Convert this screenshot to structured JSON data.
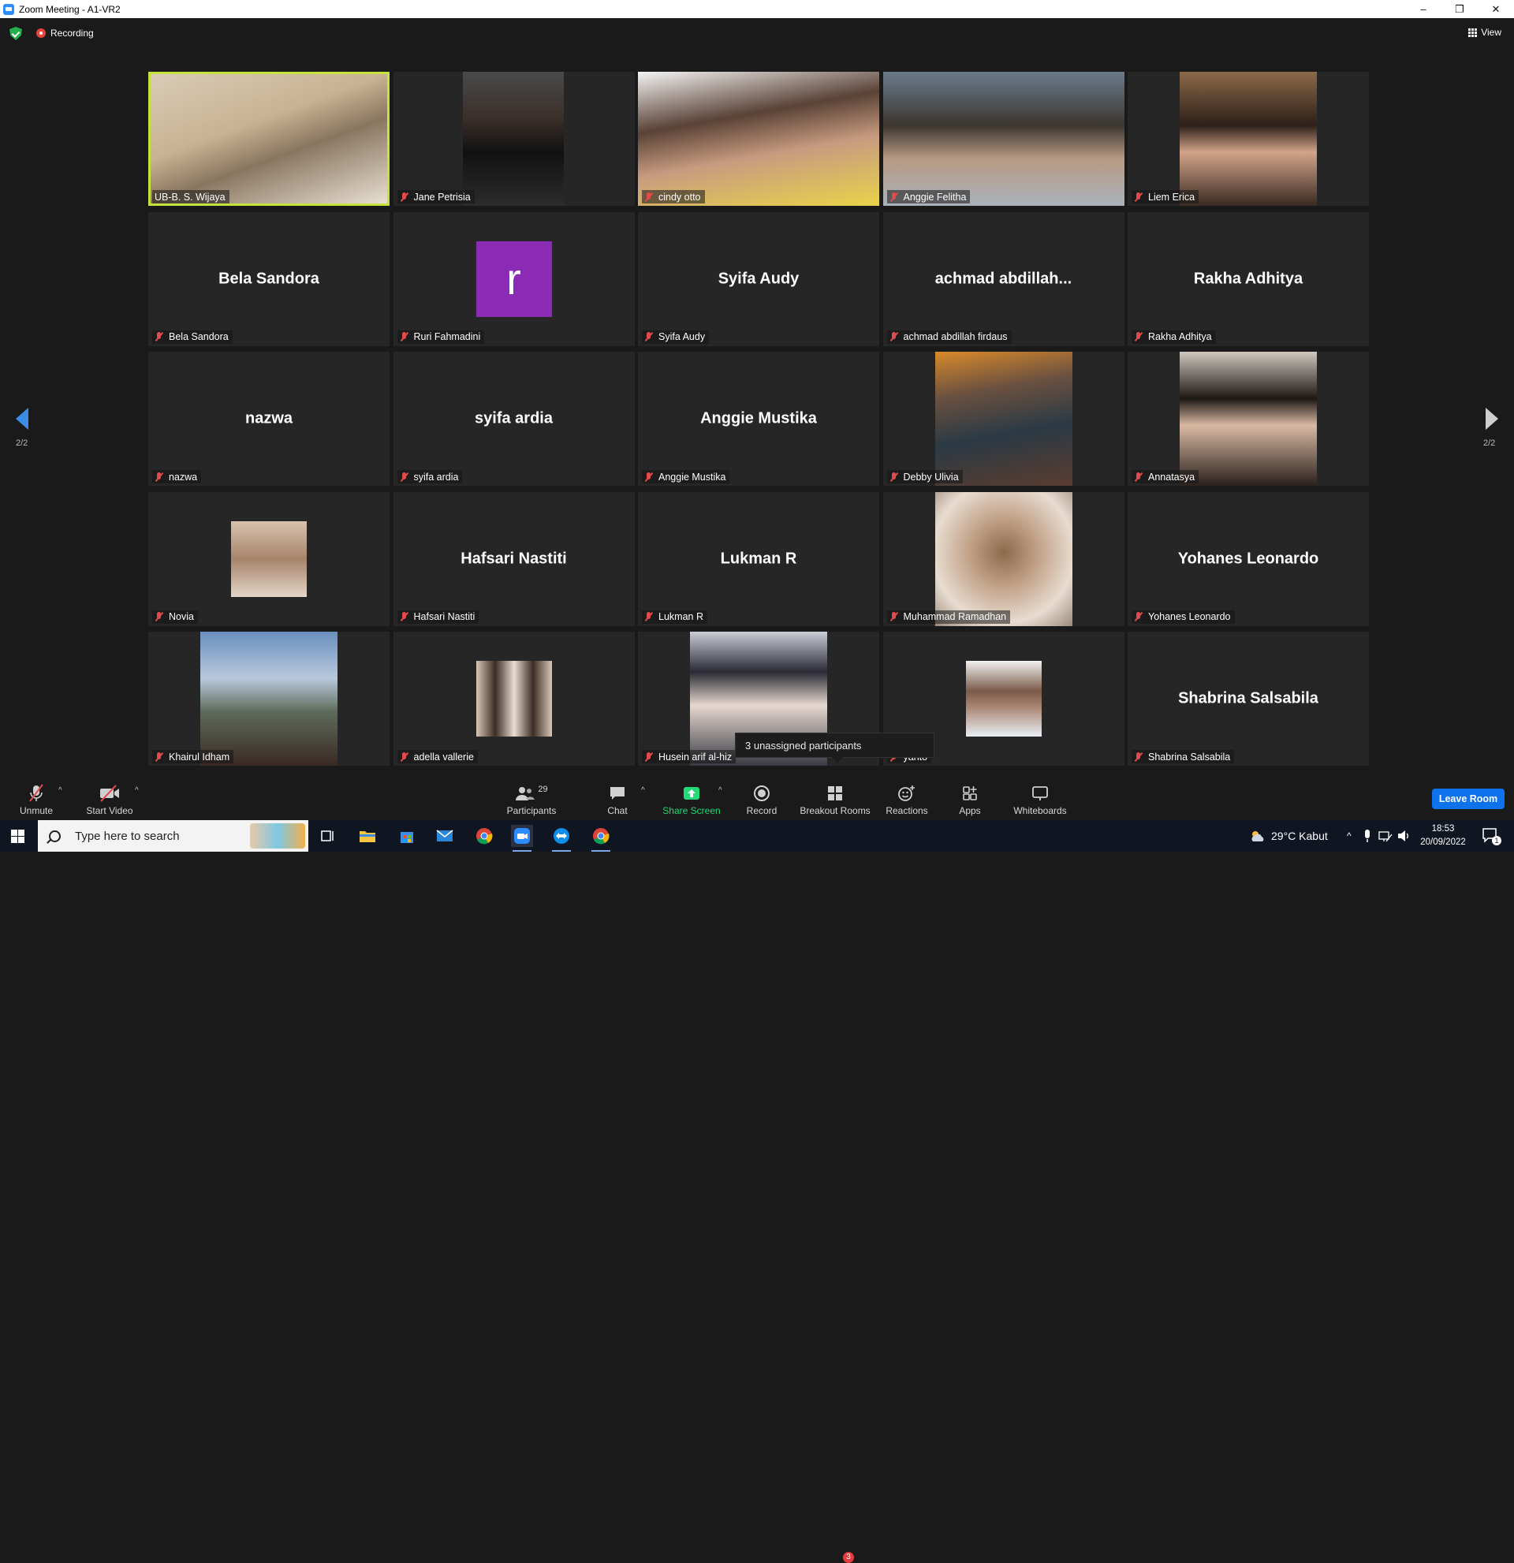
{
  "window": {
    "title": "Zoom Meeting - A1-VR2",
    "controls": [
      "–",
      "❐",
      "✕"
    ]
  },
  "topbar": {
    "recording_label": "Recording",
    "view_label": "View"
  },
  "pagination": {
    "left": "2/2",
    "right": "2/2"
  },
  "tiles": [
    {
      "label": "UB-B. S. Wijaya",
      "type": "video",
      "active": true,
      "muted": false
    },
    {
      "label": "Jane Petrisia",
      "type": "video",
      "muted": true
    },
    {
      "label": "cindy otto",
      "type": "video",
      "muted": true
    },
    {
      "label": "Anggie Felitha",
      "type": "video",
      "muted": true
    },
    {
      "label": "Liem Erica",
      "type": "video",
      "muted": true
    },
    {
      "label": "Bela Sandora",
      "type": "name",
      "display": "Bela Sandora",
      "muted": true
    },
    {
      "label": "Ruri Fahmadini",
      "type": "avatar",
      "initial": "r",
      "muted": true
    },
    {
      "label": "Syifa Audy",
      "type": "name",
      "display": "Syifa Audy",
      "muted": true
    },
    {
      "label": "achmad abdillah firdaus",
      "type": "name",
      "display": "achmad  abdillah...",
      "muted": true
    },
    {
      "label": "Rakha Adhitya",
      "type": "name",
      "display": "Rakha Adhitya",
      "muted": true
    },
    {
      "label": "nazwa",
      "type": "name",
      "display": "nazwa",
      "muted": true
    },
    {
      "label": "syifa ardia",
      "type": "name",
      "display": "syifa ardia",
      "muted": true
    },
    {
      "label": "Anggie Mustika",
      "type": "name",
      "display": "Anggie Mustika",
      "muted": true
    },
    {
      "label": "Debby Ulivia",
      "type": "video",
      "muted": true
    },
    {
      "label": "Annatasya",
      "type": "video",
      "muted": true
    },
    {
      "label": "Novia",
      "type": "profile",
      "muted": true
    },
    {
      "label": "Hafsari Nastiti",
      "type": "name",
      "display": "Hafsari Nastiti",
      "muted": true
    },
    {
      "label": "Lukman R",
      "type": "name",
      "display": "Lukman R",
      "muted": true
    },
    {
      "label": "Muhammad Ramadhan",
      "type": "video",
      "muted": true
    },
    {
      "label": "Yohanes Leonardo",
      "type": "name",
      "display": "Yohanes Leonardo",
      "muted": true
    },
    {
      "label": "Khairul Idham",
      "type": "video",
      "muted": true
    },
    {
      "label": "adella vallerie",
      "type": "profile",
      "muted": true
    },
    {
      "label": "Husein arif al-hiz",
      "type": "video",
      "muted": true
    },
    {
      "label": "yanto",
      "type": "profile",
      "muted": true
    },
    {
      "label": "Shabrina Salsabila",
      "type": "name",
      "display": "Shabrina Salsabila",
      "muted": true
    }
  ],
  "tooltip": {
    "text": "3 unassigned participants"
  },
  "toolbar": {
    "unmute": "Unmute",
    "start_video": "Start Video",
    "participants": "Participants",
    "participants_count": "29",
    "chat": "Chat",
    "share_screen": "Share Screen",
    "record": "Record",
    "breakout_rooms": "Breakout Rooms",
    "breakout_badge": "3",
    "reactions": "Reactions",
    "apps": "Apps",
    "whiteboards": "Whiteboards",
    "leave_room": "Leave Room"
  },
  "taskbar": {
    "search_placeholder": "Type here to search",
    "weather": "29°C  Kabut",
    "time": "18:53",
    "date": "20/09/2022",
    "notification_count": "1"
  },
  "colors": {
    "active_border": "#c5e33c",
    "muted_icon": "#e34b4b",
    "share_green": "#23d978",
    "leave_blue": "#0e72ed",
    "avatar_purple": "#8a2ab5"
  }
}
